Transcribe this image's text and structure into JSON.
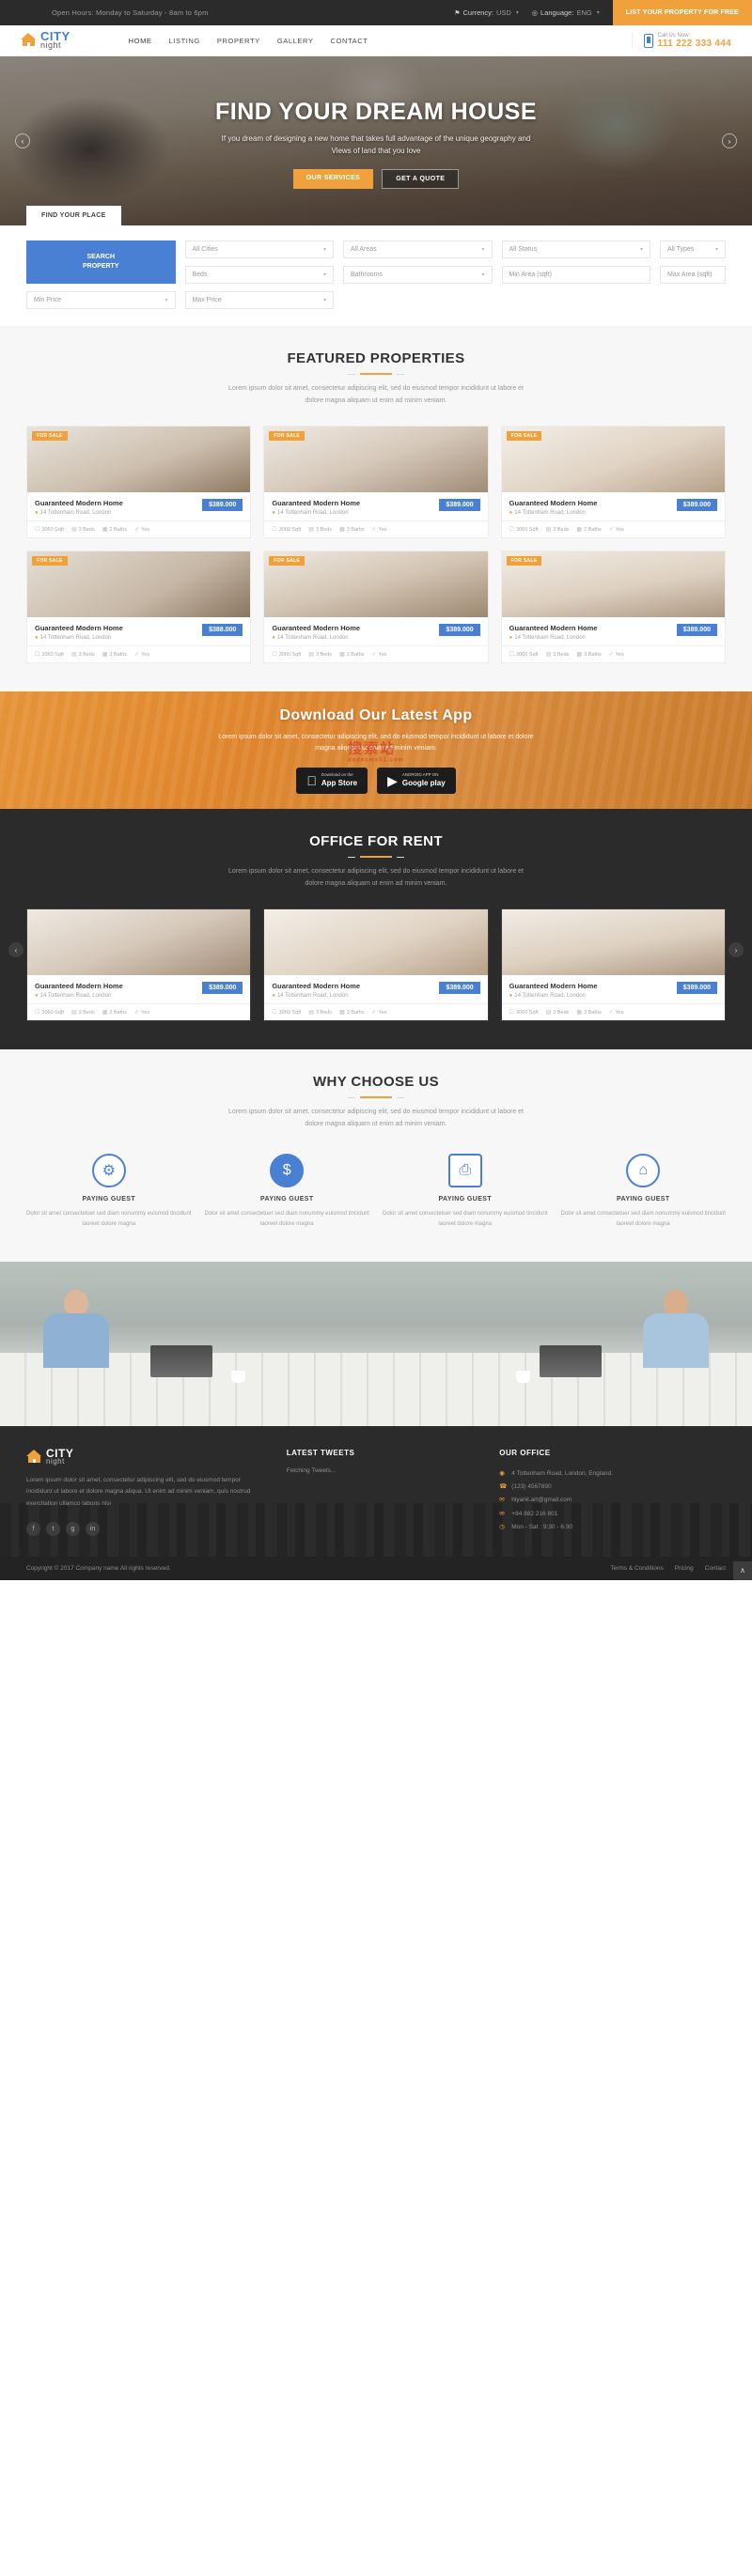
{
  "topbar": {
    "hours": "Open Hours: Monday to Saturday - 8am to 6pm",
    "currency_label": "Currency:",
    "currency_value": "USD",
    "language_label": "Language:",
    "language_value": "ENG",
    "cta": "LIST YOUR PROPERTY FOR FREE"
  },
  "header": {
    "logo_city": "CITY",
    "logo_night": "night",
    "nav": [
      {
        "label": "HOME"
      },
      {
        "label": "LISTING"
      },
      {
        "label": "PROPERTY"
      },
      {
        "label": "GALLERY"
      },
      {
        "label": "CONTACT"
      }
    ],
    "call_label": "Call Us Now",
    "call_number": "111 222 333 444"
  },
  "hero": {
    "title": "FIND YOUR DREAM HOUSE",
    "subtitle": "If you dream of designing a new home that takes full advantage of the unique geography and Views of land that you love",
    "btn_primary": "OUR SERVICES",
    "btn_secondary": "GET A QUOTE",
    "tab": "FIND YOUR PLACE",
    "arrow_left": "‹",
    "arrow_right": "›"
  },
  "search": {
    "fields": [
      {
        "value": "All Cities",
        "type": "select"
      },
      {
        "value": "All Areas",
        "type": "select"
      },
      {
        "value": "All Status",
        "type": "select"
      },
      {
        "value": "All Types",
        "type": "select"
      },
      {
        "value": "Beds",
        "type": "select"
      },
      {
        "value": "Bathrooms",
        "type": "select"
      },
      {
        "value": "Min Area (sqft)",
        "type": "input"
      },
      {
        "value": "Max Area (sqft)",
        "type": "input"
      },
      {
        "value": "Min Price",
        "type": "select"
      },
      {
        "value": "Max Price",
        "type": "select"
      }
    ],
    "button_line1": "SEARCH",
    "button_line2": "PROPERTY"
  },
  "featured": {
    "title": "FEATURED PROPERTIES",
    "subtitle": "Lorem ipsum dolor sit amet, consectetur adipiscing elit, sed do eiusmod tempor incididunt ut labore et dolore magna aliquam ut enim ad minim veniam.",
    "cards": [
      {
        "tag": "FOR SALE",
        "name": "Guaranteed Modern Home",
        "address": "14 Tottenham Road, London",
        "price": "$389.000",
        "sqft": "3060 Sqft",
        "beds": "3 Beds",
        "baths": "2 Baths",
        "extra": "Yes"
      },
      {
        "tag": "FOR SALE",
        "name": "Guaranteed Modern Home",
        "address": "14 Tottenham Road, London",
        "price": "$389.000",
        "sqft": "3060 Sqft",
        "beds": "3 Beds",
        "baths": "3 Baths",
        "extra": "Yes"
      },
      {
        "tag": "FOR SALE",
        "name": "Guaranteed Modern Home",
        "address": "14 Tottenham Road, London",
        "price": "$389.000",
        "sqft": "3060 Sqft",
        "beds": "3 Beds",
        "baths": "2 Baths",
        "extra": "Yes"
      },
      {
        "tag": "FOR SALE",
        "name": "Guaranteed Modern Home",
        "address": "14 Tottenham Road, London",
        "price": "$388.000",
        "sqft": "3060 Sqft",
        "beds": "3 Beds",
        "baths": "3 Baths",
        "extra": "Yes"
      },
      {
        "tag": "FOR SALE",
        "name": "Guaranteed Modern Home",
        "address": "14 Tottenham Road, London",
        "price": "$389.000",
        "sqft": "3060 Sqft",
        "beds": "3 Beds",
        "baths": "2 Baths",
        "extra": "Yes"
      },
      {
        "tag": "FOR SALE",
        "name": "Guaranteed Modern Home",
        "address": "14 Tottenham Road, London",
        "price": "$389.000",
        "sqft": "3060 Sqft",
        "beds": "3 Beds",
        "baths": "3 Baths",
        "extra": "Yes"
      }
    ]
  },
  "app": {
    "title": "Download Our Latest App",
    "subtitle": "Lorem ipsum dolor sit amet, consectetur adipiscing elit, sed do eiusmod tempor incididunt ut labore et dolore magna aliquam ut enim ad minim veniam.",
    "appstore_small": "Download on the",
    "appstore_big": "App Store",
    "google_small": "ANDROID APP ON",
    "google_big": "Google play",
    "watermark": "搜索站",
    "watermark_sub": "dedecms51.com"
  },
  "office": {
    "title": "OFFICE FOR RENT",
    "subtitle": "Lorem ipsum dolor sit amet, consectetur adipiscing elit, sed do eiusmod tempor incididunt ut labore et dolore magna aliquam ut enim ad minim veniam.",
    "cards": [
      {
        "name": "Guaranteed Modern Home",
        "address": "14 Tottenham Road, London",
        "price": "$389.000",
        "sqft": "3060 Sqft",
        "beds": "3 Beds",
        "baths": "2 Baths",
        "extra": "Yes"
      },
      {
        "name": "Guaranteed Modern Home",
        "address": "14 Tottenham Road, London",
        "price": "$389.000",
        "sqft": "3060 Sqft",
        "beds": "3 Beds",
        "baths": "3 Baths",
        "extra": "Yes"
      },
      {
        "name": "Guaranteed Modern Home",
        "address": "14 Tottenham Road, London",
        "price": "$389.000",
        "sqft": "3060 Sqft",
        "beds": "3 Beds",
        "baths": "3 Baths",
        "extra": "Yes"
      }
    ],
    "arrow_left": "‹",
    "arrow_right": "›"
  },
  "why": {
    "title": "WHY CHOOSE US",
    "subtitle": "Lorem ipsum dolor sit amet, consectetur adipiscing elit, sed do eiusmod tempor incididunt ut labore et dolore magna aliquam ut enim ad minim veniam.",
    "features": [
      {
        "icon": "⚙",
        "title": "PAYING GUEST",
        "text": "Dolor sit amet consectetuer sed diam nonummy euismod tincidunt laoreet dolore magna"
      },
      {
        "icon": "$",
        "title": "PAYING GUEST",
        "text": "Dolor sit amet consectetuer sed diam nonummy euismod tincidunt laoreet dolore magna"
      },
      {
        "icon": "⎙",
        "title": "PAYING GUEST",
        "text": "Dolor sit amet consectetuer sed diam nonummy euismod tincidunt laoreet dolore magna"
      },
      {
        "icon": "⌂",
        "title": "PAYING GUEST",
        "text": "Dolor sit amet consectetuer sed diam nonummy euismod tincidunt laoreet dolore magna"
      }
    ]
  },
  "footer": {
    "logo_city": "CITY",
    "logo_night": "night",
    "about": "Lorem ipsum dolor sit amet, consectetur adipiscing elit, sed do eiusmod tempor incididunt ut labore et dolore magna aliqua. Ut enim ad minim veniam, quis nostrud exercitation ullamco laboris nisi",
    "socials": [
      "f",
      "t",
      "g",
      "in"
    ],
    "tweets_title": "LATEST TWEETS",
    "tweets_text": "Fetching Tweets...",
    "office_title": "OUR OFFICE",
    "contacts": [
      {
        "icon": "◉",
        "text": "4 Tottenham Road, London, England."
      },
      {
        "icon": "☎",
        "text": "(123) 4567890"
      },
      {
        "icon": "✉",
        "text": "hiyanil.art@gmail.com"
      },
      {
        "icon": "✉",
        "text": "+84 882 216 801"
      },
      {
        "icon": "◷",
        "text": "Mon - Sat : 9:30 - 6:30"
      }
    ],
    "copyright": "Copyright © 2017 Company name All rights reserved.",
    "links": [
      "Terms & Conditions",
      "Pricing",
      "Contact"
    ],
    "totop": "∧"
  }
}
